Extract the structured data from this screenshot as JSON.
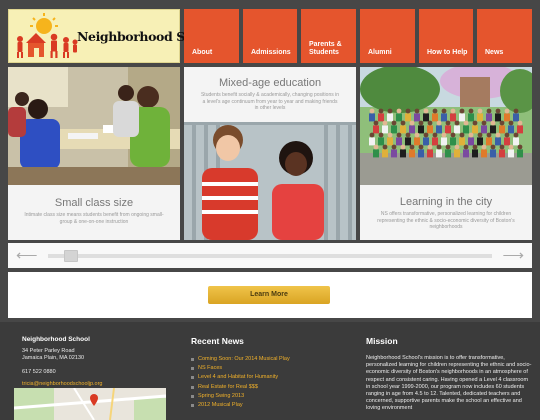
{
  "header": {
    "logo_text": "Neighborhood School",
    "nav": [
      {
        "label": "About"
      },
      {
        "label": "Admissions"
      },
      {
        "label": "Parents & Students"
      },
      {
        "label": "Alumni"
      },
      {
        "label": "How to Help"
      },
      {
        "label": "News"
      }
    ]
  },
  "features": [
    {
      "title": "Small class size",
      "desc": "Intimate class size means students benefit from ongoing small-group & one-on-one instruction"
    },
    {
      "title": "Mixed-age education",
      "desc": "Students benefit socially & academically, changing positions in a level's age continuum from year to year and making friends in other levels"
    },
    {
      "title": "Learning in the city",
      "desc": "NS offers transformative, personalized learning for children representing the ethnic & socio-economic diversity of Boston's neighborhoods"
    }
  ],
  "slider": {
    "prev_icon": "arrow-left-icon",
    "next_icon": "arrow-right-icon"
  },
  "cta": {
    "label": "Learn More"
  },
  "footer": {
    "address": {
      "title": "Neighborhood School",
      "line1": "34 Peter Parley Road",
      "line2": "Jamaica Plain, MA 02130",
      "phone": "617 522 0880",
      "email": "tricia@neighborhoodschooljp.org"
    },
    "news": {
      "heading": "Recent News",
      "items": [
        "Coming Soon: Our 2014 Musical Play",
        "NS Faces",
        "Level 4 and Habitat for Humanity",
        "Real Estate for Real $$$",
        "Spring Swing 2013",
        "2012 Musical Play"
      ]
    },
    "mission": {
      "heading": "Mission",
      "text": "Neighborhood School's mission is to offer transformative, personalized learning for children representing the ethnic and socio-economic diversity of Boston's neighborhoods in an atmosphere of respect and consistent caring. Having opened a Level 4 classroom in school year 1999-2000, our program now includes 60 students ranging in age from 4.5 to 12. Talented, dedicated teachers and concerned, supportive parents make the school an effective and loving environment"
    }
  },
  "colors": {
    "nav": "#e5552d",
    "accent": "#f1b12a",
    "background": "#474747",
    "footer": "#3b3b3b"
  }
}
